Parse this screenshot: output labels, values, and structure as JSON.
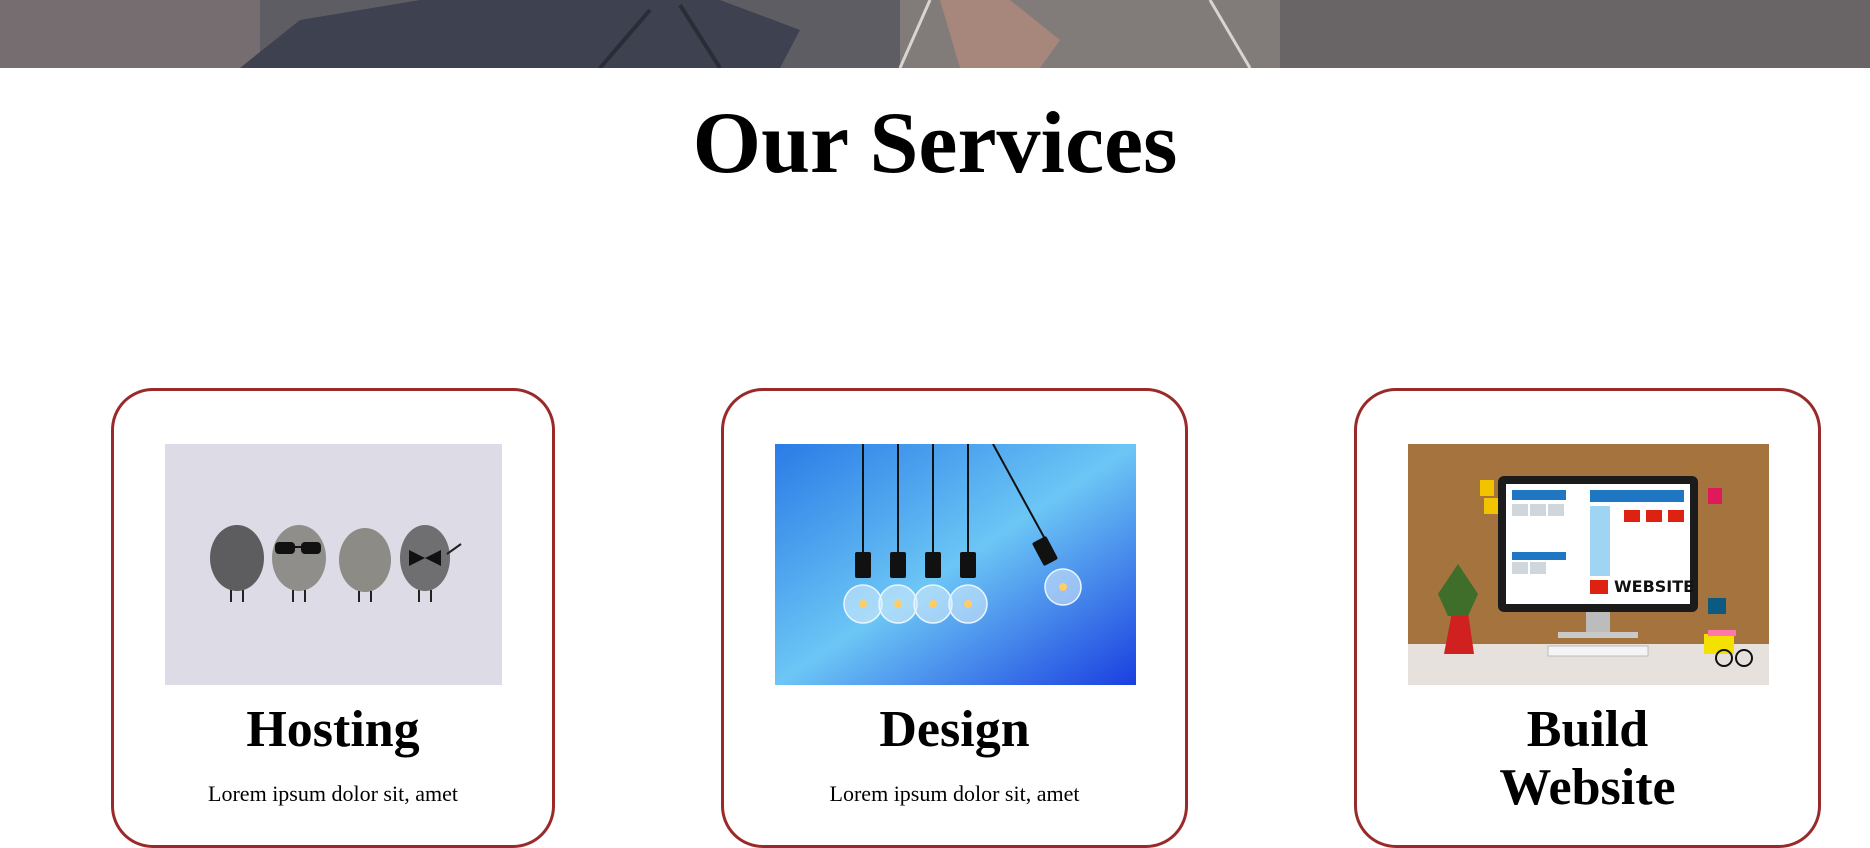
{
  "section": {
    "title": "Our Services"
  },
  "cards": [
    {
      "title": "Hosting",
      "text": "Lorem ipsum dolor sit, amet",
      "image_icon": "pebble-characters-image"
    },
    {
      "title": "Design",
      "text": "Lorem ipsum dolor sit, amet",
      "image_icon": "light-bulbs-cradle-image"
    },
    {
      "title": "Build Website",
      "text": "",
      "image_icon": "website-monitor-desk-image"
    }
  ],
  "colors": {
    "card_border": "#9a2a2a",
    "background": "#ffffff",
    "text": "#000000"
  }
}
